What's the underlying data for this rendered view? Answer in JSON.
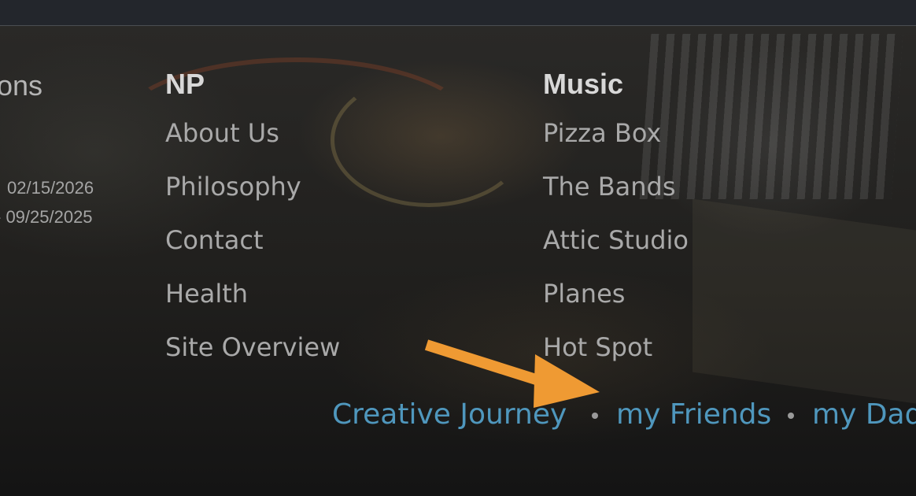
{
  "left_column": {
    "heading_partial": "ons",
    "dates": [
      "02/15/2026",
      "- 09/25/2025"
    ]
  },
  "np_column": {
    "heading": "NP",
    "links": [
      "About Us",
      "Philosophy",
      "Contact",
      "Health",
      "Site Overview"
    ]
  },
  "music_column": {
    "heading": "Music",
    "links": [
      "Pizza Box",
      "The Bands",
      "Attic Studio",
      "Planes",
      "Hot Spot"
    ]
  },
  "bottom_nav": {
    "links": [
      "Creative Journey",
      "my Friends",
      "my Dad"
    ],
    "separator": "•"
  },
  "colors": {
    "link_blue": "#4f97bd",
    "arrow_orange": "#ef9a33",
    "text_gray": "#a9a9a9"
  },
  "annotation": {
    "arrow_icon": "arrow-pointer-icon"
  }
}
